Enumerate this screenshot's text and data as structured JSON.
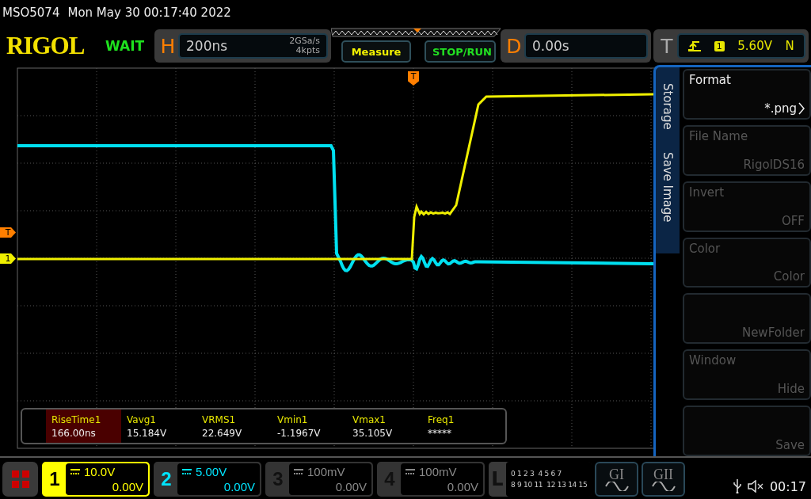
{
  "header": {
    "model": "MSO5074",
    "datetime": "Mon May 30 00:17:40 2022"
  },
  "toolbar": {
    "logo": "RIGOL",
    "status": "WAIT",
    "horizontal": {
      "label": "H",
      "timebase": "200ns",
      "sample_rate": "2GSa/s",
      "memory_depth": "4kpts"
    },
    "buttons": [
      {
        "label": "Measure",
        "kind": "measure"
      },
      {
        "label": "STOP/RUN",
        "kind": "run"
      }
    ],
    "delay": {
      "label": "D",
      "value": "0.00s"
    },
    "trigger": {
      "label": "T",
      "source": "1",
      "level": "5.60V",
      "mode": "N"
    }
  },
  "display": {
    "trigger_position_marker": "T",
    "level_markers": [
      {
        "label": "T",
        "kind": "trigger"
      },
      {
        "label": "1",
        "kind": "channel"
      }
    ]
  },
  "measurements": [
    {
      "name": "RiseTime1",
      "value": "166.00ns",
      "selected": true
    },
    {
      "name": "Vavg1",
      "value": "15.184V",
      "selected": false
    },
    {
      "name": "VRMS1",
      "value": "22.649V",
      "selected": false
    },
    {
      "name": "Vmin1",
      "value": "-1.1967V",
      "selected": false
    },
    {
      "name": "Vmax1",
      "value": "35.105V",
      "selected": false
    },
    {
      "name": "Freq1",
      "value": "*****",
      "selected": false
    }
  ],
  "menu": {
    "tabs": [
      "Storage",
      "Save Image"
    ],
    "items": [
      {
        "label": "Format",
        "value": "*.png",
        "disabled": false,
        "submenu": true
      },
      {
        "label": "File Name",
        "value": "RigolDS16",
        "disabled": true,
        "submenu": false
      },
      {
        "label": "Invert",
        "value": "OFF",
        "disabled": true,
        "submenu": false
      },
      {
        "label": "Color",
        "value": "Color",
        "disabled": true,
        "submenu": false
      },
      {
        "value": "NewFolder",
        "disabled": true,
        "submenu": false
      },
      {
        "label": "Window",
        "value": "Hide",
        "disabled": true,
        "submenu": false
      },
      {
        "value": "Save",
        "disabled": true,
        "submenu": false
      }
    ]
  },
  "channels": [
    {
      "number": "1",
      "scale": "10.0V",
      "offset": "0.00V",
      "on": true,
      "color": "#ffff00",
      "selected": true
    },
    {
      "number": "2",
      "scale": "5.00V",
      "offset": "0.00V",
      "on": true,
      "color": "#00e5ff",
      "selected": false
    },
    {
      "number": "3",
      "scale": "100mV",
      "offset": "0.00V",
      "on": false,
      "selected": false
    },
    {
      "number": "4",
      "scale": "100mV",
      "offset": "0.00V",
      "on": false,
      "selected": false
    }
  ],
  "logic": {
    "label": "L",
    "rows": [
      "0 1 2 3  4 5 6 7",
      "8 9 10 11  12 13 14 15"
    ]
  },
  "generators": [
    {
      "label": "GI"
    },
    {
      "label": "GII"
    }
  ],
  "status": {
    "time": "00:17"
  }
}
